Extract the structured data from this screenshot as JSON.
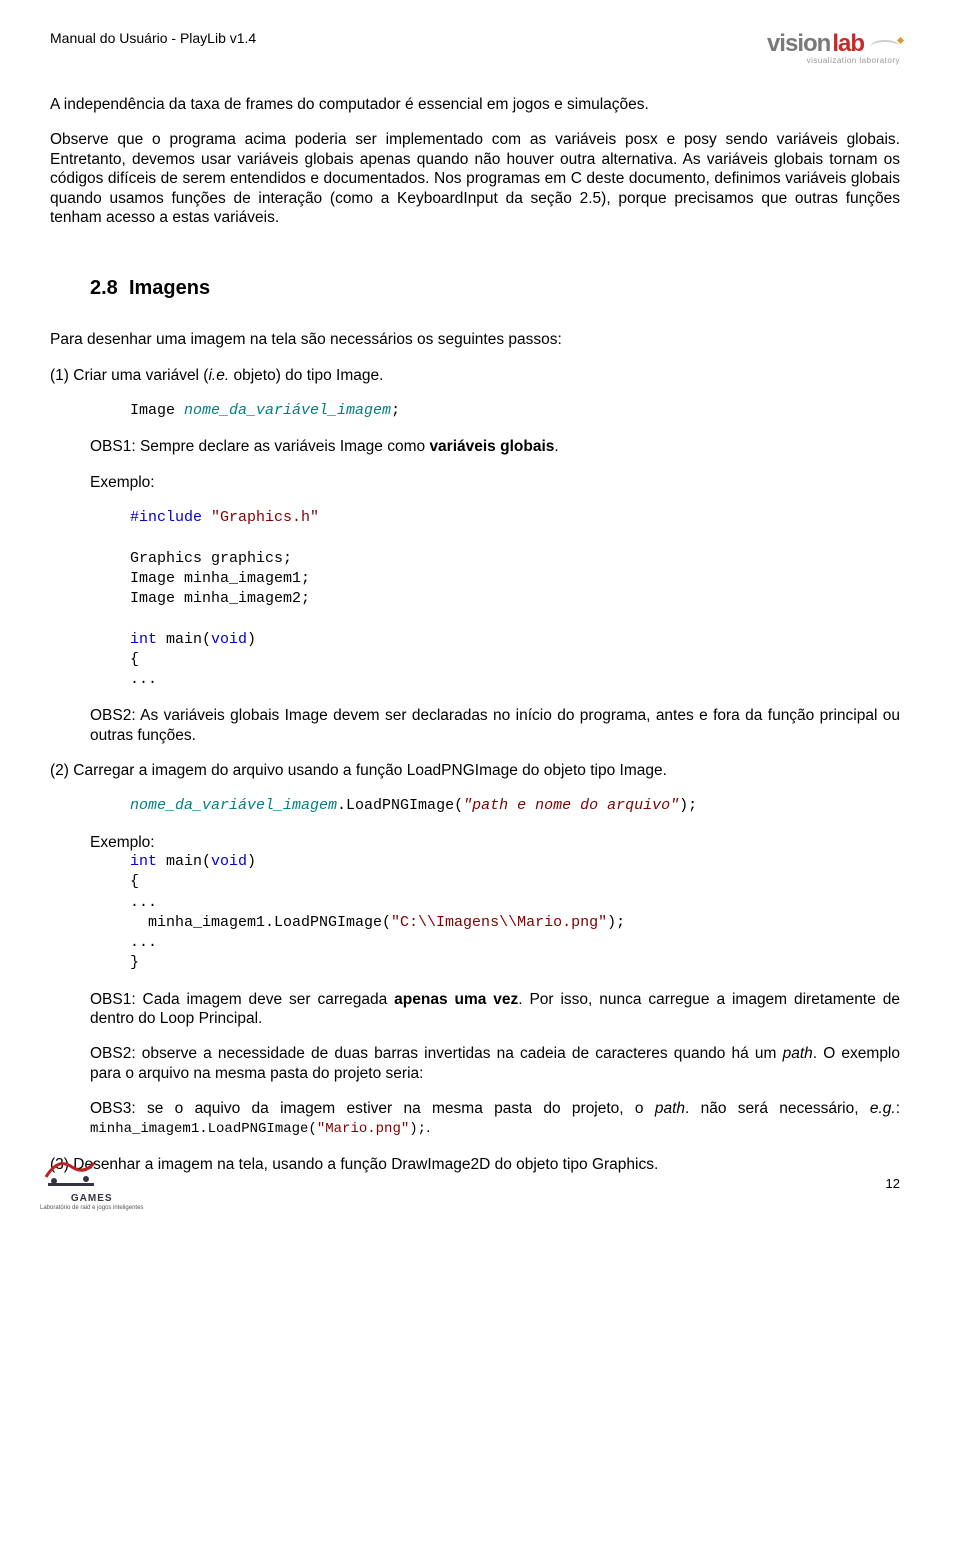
{
  "header": {
    "title": "Manual do Usuário - PlayLib v1.4",
    "logo_vision": "vision",
    "logo_lab": "lab",
    "logo_sub": "visualization laboratory"
  },
  "para1": "A independência da taxa de frames do computador é essencial em jogos e simulações.",
  "para2": "Observe que o programa acima poderia ser implementado com as variáveis posx e posy sendo variáveis globais. Entretanto, devemos usar variáveis globais apenas quando não houver outra alternativa. As variáveis globais tornam os códigos difíceis de serem entendidos e documentados. Nos programas em C deste documento, definimos variáveis globais quando usamos funções de interação (como a KeyboardInput da seção 2.5), porque precisamos que outras funções tenham acesso a estas variáveis.",
  "section": {
    "number": "2.8",
    "title": "Imagens"
  },
  "para3": "Para desenhar uma imagem na tela são necessários os seguintes passos:",
  "step1": {
    "prefix": "(1) Criar uma variável (",
    "ie": "i.e.",
    "suffix": " objeto) do tipo Image."
  },
  "code1": {
    "l1_a": "Image ",
    "l1_b": "nome_da_variável_imagem",
    "l1_c": ";"
  },
  "obs1": {
    "prefix": "OBS1: Sempre declare as variáveis Image como ",
    "bold": "variáveis globais",
    "suffix": "."
  },
  "exemplo": "Exemplo:",
  "code2": {
    "l1_a": "#include",
    "l1_b": " \"Graphics.h\"",
    "l3": "Graphics graphics;",
    "l4": "Image minha_imagem1;",
    "l5": "Image minha_imagem2;",
    "l7_a": "int",
    "l7_b": " main(",
    "l7_c": "void",
    "l7_d": ")",
    "l8": "{",
    "l9": "..."
  },
  "obs2": "OBS2: As variáveis globais Image devem ser declaradas no início do programa, antes e fora da função principal ou outras funções.",
  "step2": "(2) Carregar a imagem do arquivo usando a função LoadPNGImage do objeto tipo Image.",
  "code3": {
    "l1_a": "nome_da_variável_imagem",
    "l1_b": ".LoadPNGImage(",
    "l1_c": "\"path e nome do arquivo\"",
    "l1_d": ");"
  },
  "code4": {
    "l0": "Exemplo:",
    "l1_a": "int",
    "l1_b": " main(",
    "l1_c": "void",
    "l1_d": ")",
    "l2": "{",
    "l3": "...",
    "l4_a": "  minha_imagem1.LoadPNGImage(",
    "l4_b": "\"C:\\\\Imagens\\\\Mario.png\"",
    "l4_c": ");",
    "l5": "...",
    "l6": "}"
  },
  "obs3_1": {
    "prefix": "OBS1: Cada imagem deve ser carregada ",
    "bold": "apenas uma vez",
    "suffix": ". Por isso, nunca carregue a imagem diretamente de dentro do Loop Principal."
  },
  "obs3_2": {
    "a": "OBS2: observe a necessidade de duas barras invertidas na cadeia de caracteres quando há um ",
    "b": "path",
    "c": ". O exemplo para o arquivo na mesma pasta do projeto seria:"
  },
  "obs3_3": {
    "a": "OBS3: se o aquivo da imagem estiver na mesma pasta do projeto, o ",
    "b": "path",
    "c": ". não será necessário, ",
    "d": "e.g.",
    "e": ": ",
    "f": "minha_imagem1.LoadPNGImage(",
    "g": "\"Mario.png\"",
    "h": ");",
    "i": "."
  },
  "step3": "(3) Desenhar a imagem na tela, usando a função DrawImage2D do objeto tipo Graphics.",
  "page_number": "12",
  "footer": {
    "games": "GAMES",
    "sub": "Laboratório de raid e jogos inteligentes"
  }
}
